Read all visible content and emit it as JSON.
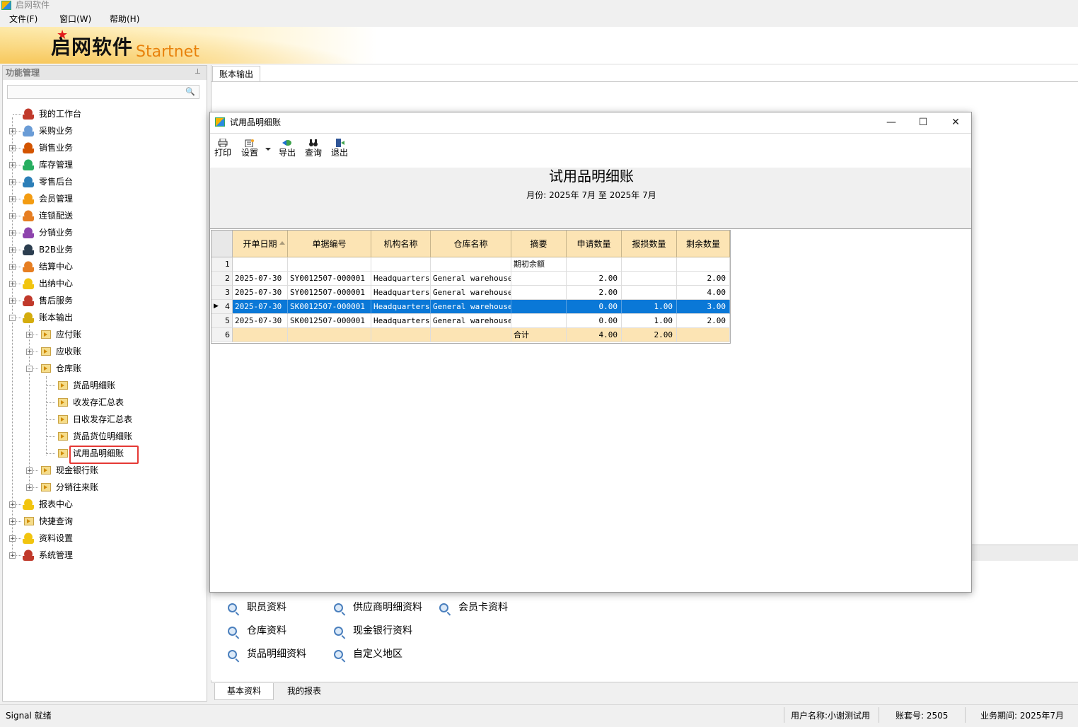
{
  "app": {
    "title": "启网软件"
  },
  "menu": [
    "文件(F)",
    "窗口(W)",
    "帮助(H)"
  ],
  "logo": {
    "cn": "启网软件",
    "en": "Startnet"
  },
  "left_panel": {
    "title": "功能管理",
    "tree": [
      {
        "label": "我的工作台"
      },
      {
        "label": "采购业务"
      },
      {
        "label": "销售业务"
      },
      {
        "label": "库存管理"
      },
      {
        "label": "零售后台"
      },
      {
        "label": "会员管理"
      },
      {
        "label": "连锁配送"
      },
      {
        "label": "分销业务"
      },
      {
        "label": "B2B业务"
      },
      {
        "label": "结算中心"
      },
      {
        "label": "出纳中心"
      },
      {
        "label": "售后服务"
      },
      {
        "label": "账本输出"
      },
      {
        "label": "应付账"
      },
      {
        "label": "应收账"
      },
      {
        "label": "仓库账"
      },
      {
        "label": "货品明细账"
      },
      {
        "label": "收发存汇总表"
      },
      {
        "label": "日收发存汇总表"
      },
      {
        "label": "货品货位明细账"
      },
      {
        "label": "试用品明细账"
      },
      {
        "label": "现金银行账"
      },
      {
        "label": "分销往来账"
      },
      {
        "label": "报表中心"
      },
      {
        "label": "快捷查询"
      },
      {
        "label": "资料设置"
      },
      {
        "label": "系统管理"
      }
    ]
  },
  "tabs": {
    "active": "账本输出"
  },
  "dialog": {
    "title": "试用品明细账",
    "toolbar": [
      "打印",
      "设置",
      "导出",
      "查询",
      "退出"
    ],
    "report_title": "试用品明细账",
    "report_subtitle": "月份: 2025年 7月  至  2025年 7月",
    "columns": [
      "开单日期",
      "单据编号",
      "机构名称",
      "仓库名称",
      "摘要",
      "申请数量",
      "报损数量",
      "剩余数量"
    ],
    "rows": [
      {
        "n": "1",
        "date": "",
        "no": "",
        "org": "",
        "wh": "",
        "memo": "期初余额",
        "req": "",
        "loss": "",
        "rem": ""
      },
      {
        "n": "2",
        "date": "2025-07-30",
        "no": "SY0012507-000001",
        "org": "Headquarters",
        "wh": "General warehouse",
        "memo": "",
        "req": "2.00",
        "loss": "",
        "rem": "2.00"
      },
      {
        "n": "3",
        "date": "2025-07-30",
        "no": "SY0012507-000001",
        "org": "Headquarters",
        "wh": "General warehouse",
        "memo": "",
        "req": "2.00",
        "loss": "",
        "rem": "4.00"
      },
      {
        "n": "4",
        "date": "2025-07-30",
        "no": "SK0012507-000001",
        "org": "Headquarters",
        "wh": "General warehouse",
        "memo": "",
        "req": "0.00",
        "loss": "1.00",
        "rem": "3.00"
      },
      {
        "n": "5",
        "date": "2025-07-30",
        "no": "SK0012507-000001",
        "org": "Headquarters",
        "wh": "General warehouse",
        "memo": "",
        "req": "0.00",
        "loss": "1.00",
        "rem": "2.00"
      },
      {
        "n": "6",
        "date": "",
        "no": "",
        "org": "",
        "wh": "",
        "memo": "合计",
        "req": "4.00",
        "loss": "2.00",
        "rem": ""
      }
    ],
    "selected_row": "4"
  },
  "quick_links": [
    "职员资料",
    "供应商明细资料",
    "会员卡资料",
    "仓库资料",
    "现金银行资料",
    "货品明细资料",
    "自定义地区"
  ],
  "bottom_tabs": [
    "基本资料",
    "我的报表"
  ],
  "status": {
    "left": "Signal 就绪",
    "user": "用户名称:小谢测试用",
    "account": "账套号: 2505",
    "period": "业务期间: 2025年7月"
  },
  "colors": {
    "selected_row": "#0a78d7",
    "header_bg": "#fce4b4",
    "logo_star": "#e21b1b",
    "logo_en": "#e8820c",
    "highlight_box": "#e53935"
  }
}
